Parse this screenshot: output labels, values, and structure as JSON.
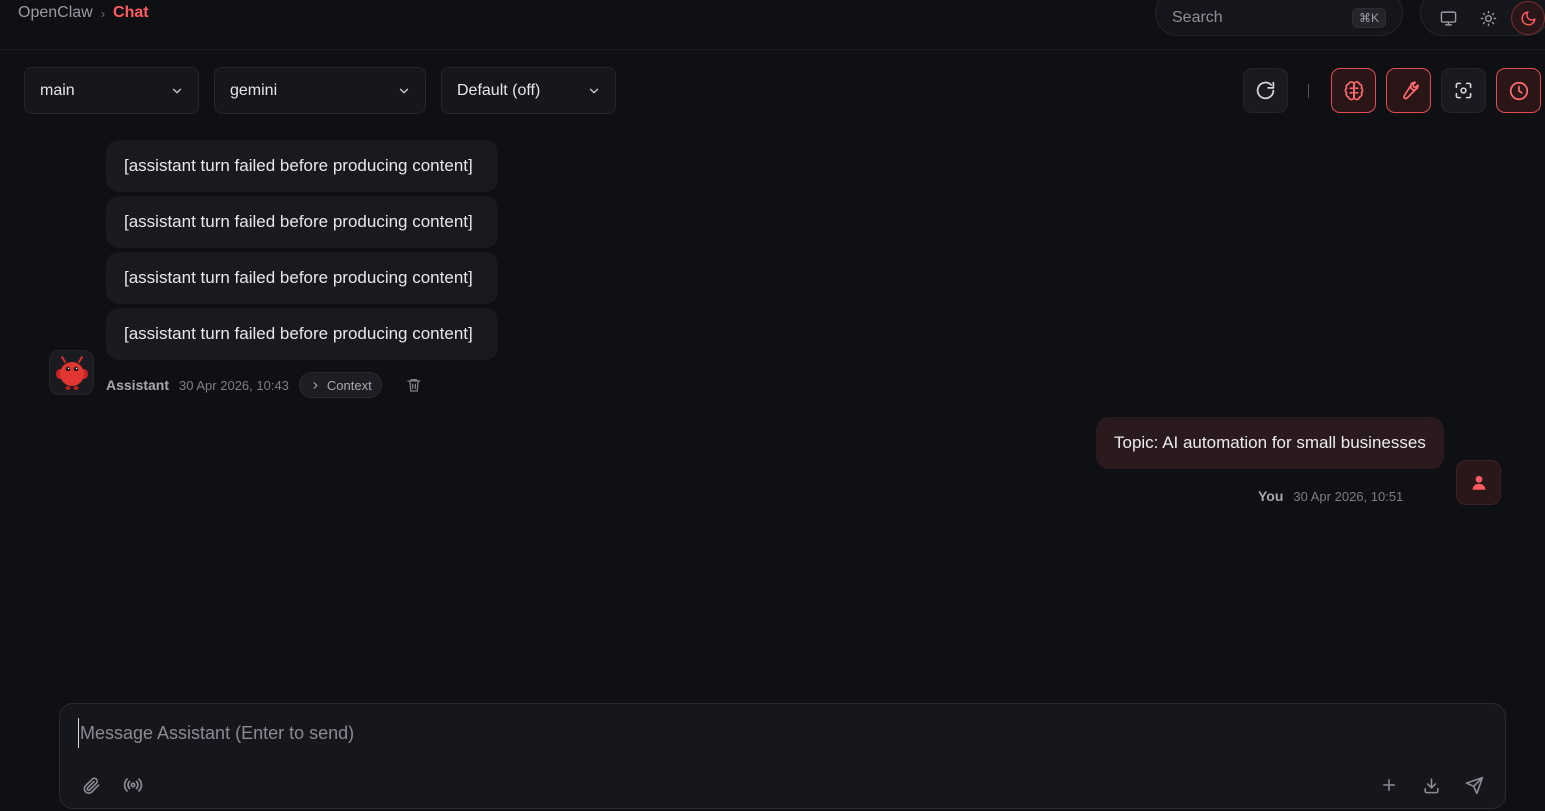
{
  "breadcrumb": {
    "root": "OpenClaw",
    "separator": "›",
    "current": "Chat"
  },
  "search": {
    "label": "Search",
    "shortcut": "⌘K"
  },
  "theme": {
    "buttons": [
      {
        "name": "monitor-icon",
        "active": false
      },
      {
        "name": "sun-icon",
        "active": false
      },
      {
        "name": "moon-icon",
        "active": true
      }
    ]
  },
  "toolbar": {
    "agent_select": "main",
    "model_select": "gemini",
    "thinking_select": "Default (off)",
    "buttons": [
      {
        "name": "refresh-icon",
        "active": false
      },
      {
        "name": "brain-icon",
        "active": true
      },
      {
        "name": "wrench-icon",
        "active": true
      },
      {
        "name": "focus-icon",
        "active": false
      },
      {
        "name": "clock-icon",
        "active": true
      }
    ]
  },
  "messages": {
    "assistant": {
      "bubbles": [
        "[assistant turn failed before producing content]",
        "[assistant turn failed before producing content]",
        "[assistant turn failed before producing content]",
        "[assistant turn failed before producing content]"
      ],
      "name": "Assistant",
      "time": "30 Apr 2026, 10:43",
      "context_label": "Context"
    },
    "user": {
      "text": "Topic: AI automation for small businesses",
      "name": "You",
      "time": "30 Apr 2026, 10:51"
    }
  },
  "composer": {
    "placeholder": "Message Assistant (Enter to send)",
    "value": ""
  },
  "colors": {
    "accent": "#ff5a5f",
    "background": "#0f1014",
    "bubble": "#191a20",
    "user_bubble": "#2a1a1d"
  }
}
